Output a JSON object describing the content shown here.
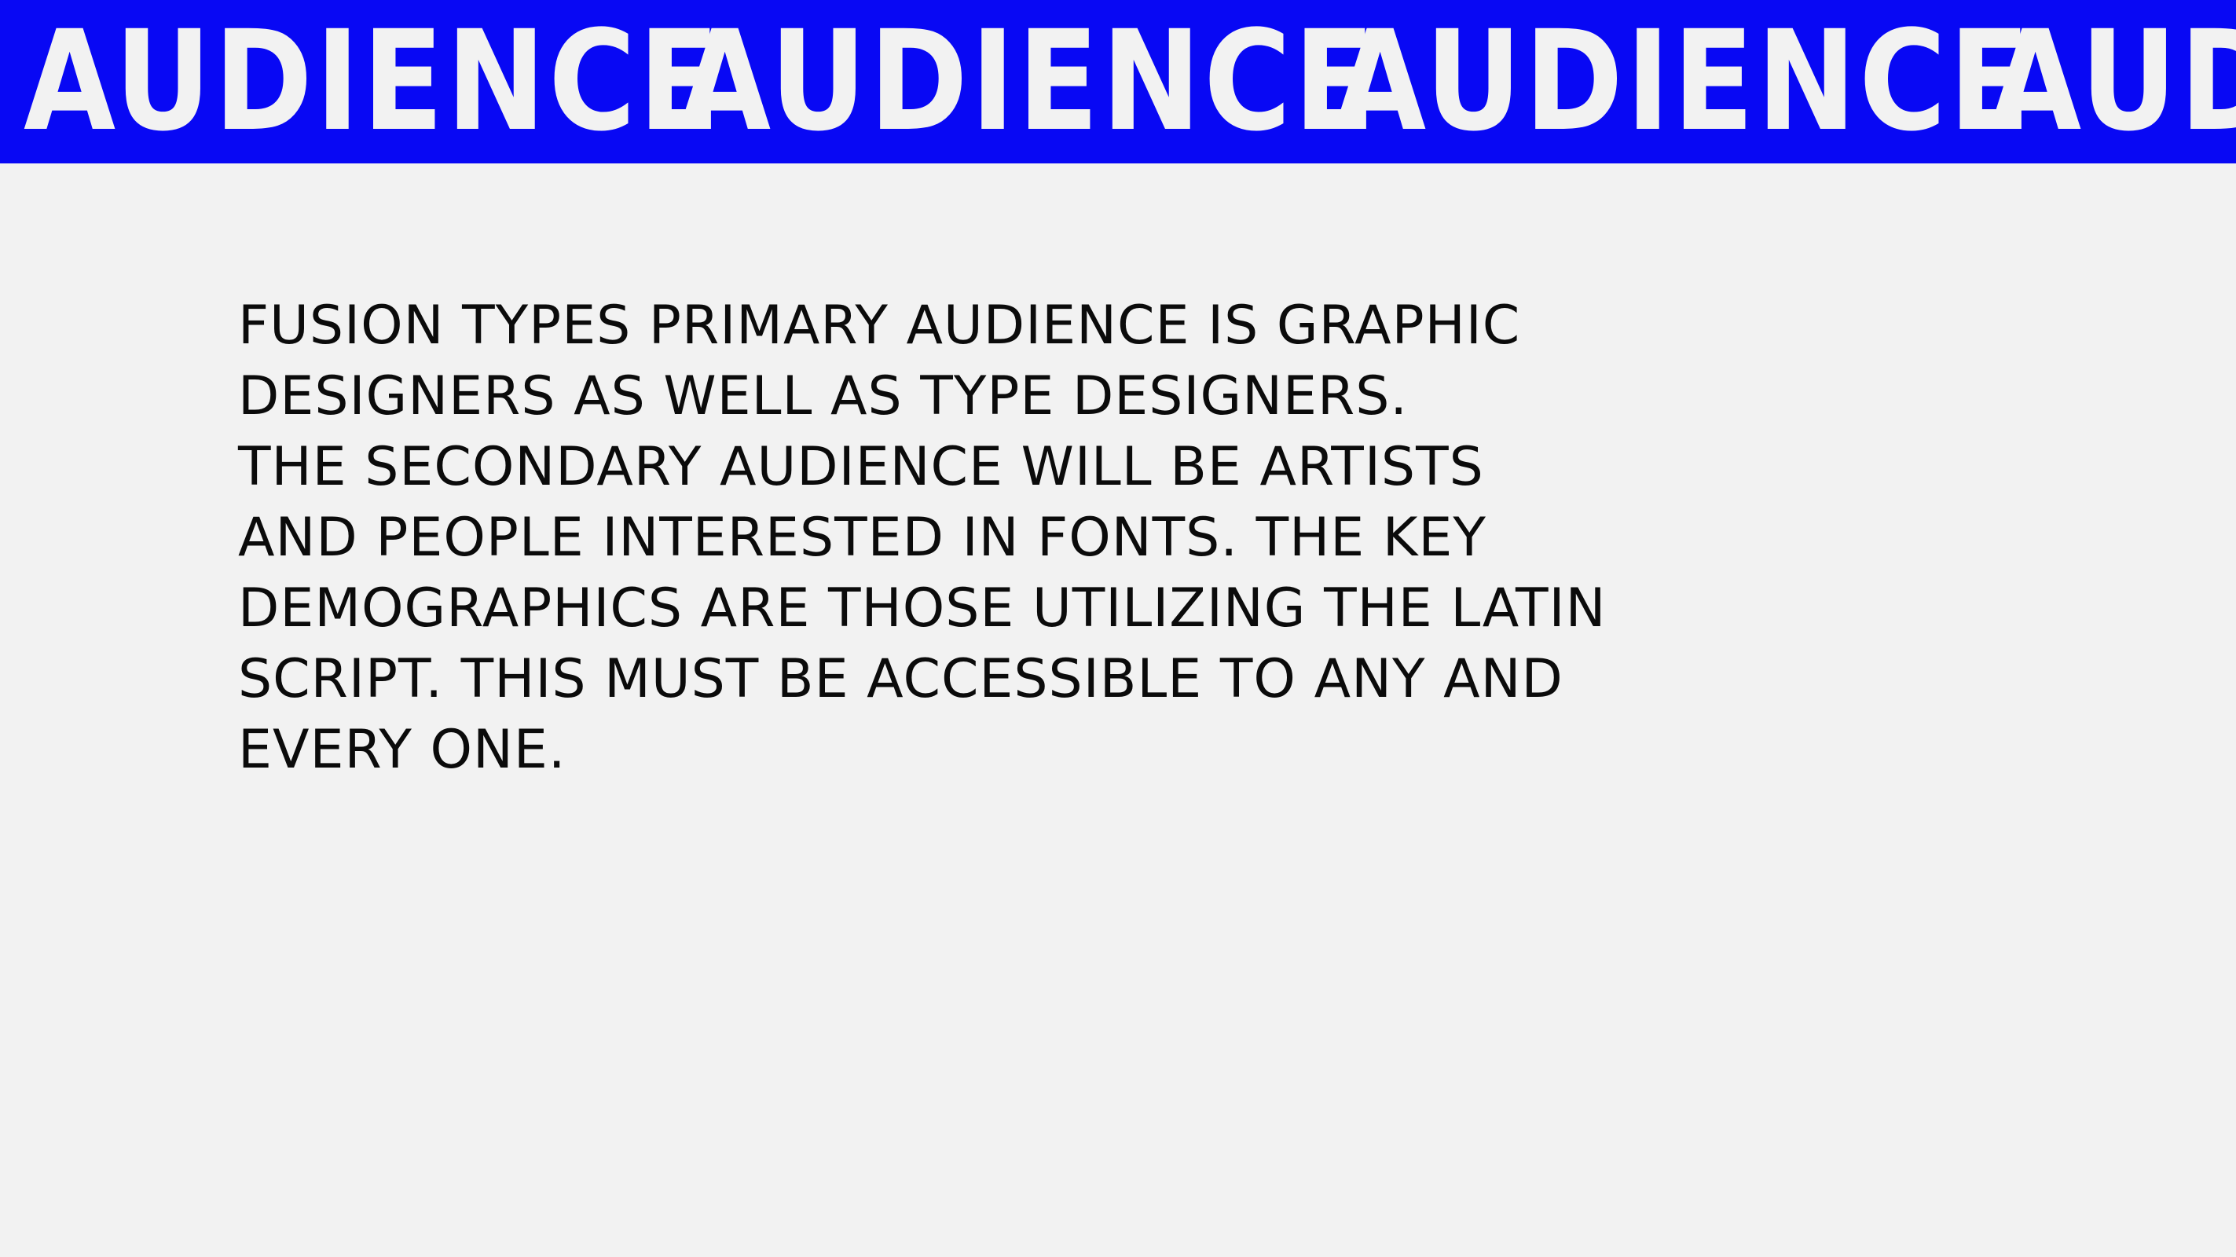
{
  "banner": {
    "words": [
      "AUDIENCE",
      "AUDIENCE",
      "AUDIENCE",
      "AUD"
    ],
    "background_color": "#0808f4",
    "text_color": "#f2f2f2"
  },
  "content": {
    "lines": [
      "FUSION TYPES PRIMARY AUDIENCE IS GRAPHIC",
      "DESIGNERS AS WELL AS TYPE DESIGNERS.",
      "THE SECONDARY AUDIENCE WILL BE ARTISTS",
      "AND PEOPLE INTERESTED IN FONTS. THE KEY",
      "DEMOGRAPHICS ARE THOSE UTILIZING THE LATIN",
      "SCRIPT. THIS MUST BE ACCESSIBLE TO ANY AND",
      "EVERY ONE."
    ],
    "text_color": "#0b0b0b",
    "page_background": "#f2f2f2"
  }
}
